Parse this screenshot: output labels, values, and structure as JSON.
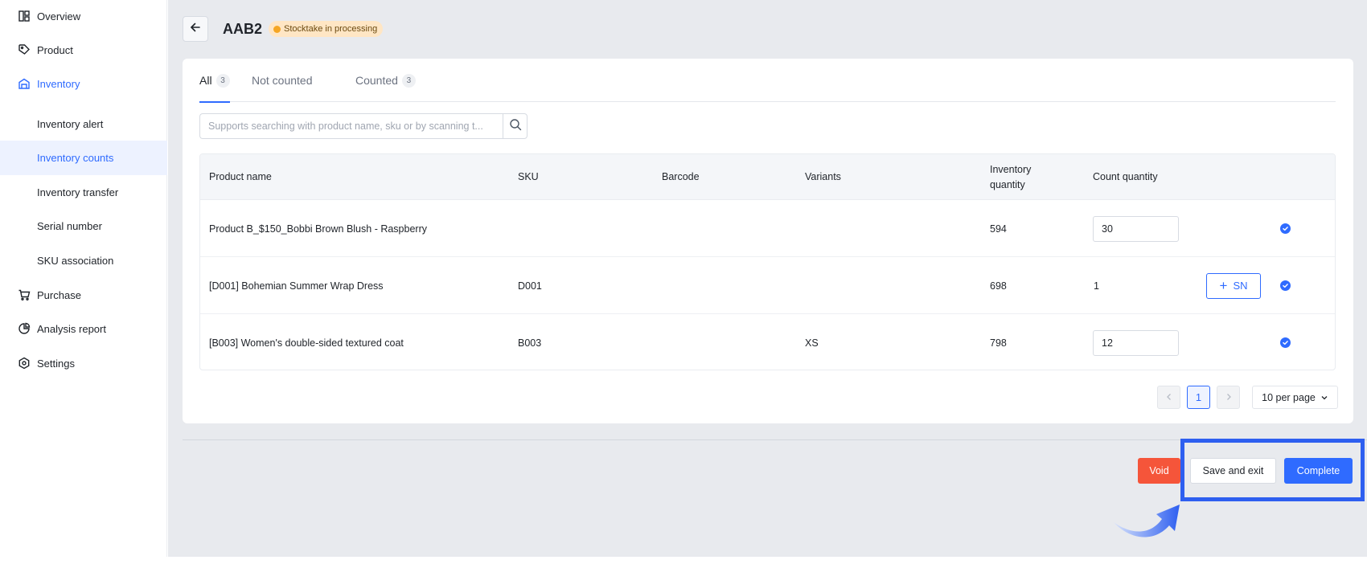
{
  "sidebar": {
    "items": [
      {
        "label": "Overview",
        "icon": "layout-grid-icon"
      },
      {
        "label": "Product",
        "icon": "tag-icon"
      },
      {
        "label": "Inventory",
        "icon": "warehouse-icon"
      },
      {
        "label": "Inventory alert"
      },
      {
        "label": "Inventory counts"
      },
      {
        "label": "Inventory transfer"
      },
      {
        "label": "Serial number"
      },
      {
        "label": "SKU association"
      },
      {
        "label": "Purchase",
        "icon": "cart-icon"
      },
      {
        "label": "Analysis report",
        "icon": "pie-chart-icon"
      },
      {
        "label": "Settings",
        "icon": "settings-hex-icon"
      }
    ]
  },
  "header": {
    "title": "AAB2",
    "status": "Stocktake in processing"
  },
  "tabs": [
    {
      "label": "All",
      "count": "3"
    },
    {
      "label": "Not counted"
    },
    {
      "label": "Counted",
      "count": "3"
    }
  ],
  "search": {
    "placeholder": "Supports searching with product name, sku or by scanning t..."
  },
  "table": {
    "headers": [
      "Product name",
      "SKU",
      "Barcode",
      "Variants",
      "Inventory quantity",
      "Count quantity"
    ],
    "header_inventory_line1": "Inventory",
    "header_inventory_line2": "quantity",
    "rows": [
      {
        "name": "Product B_$150_Bobbi Brown Blush - Raspberry",
        "sku": "",
        "barcode": "",
        "variants": "",
        "inventory": "594",
        "count": "30"
      },
      {
        "name": "[D001] Bohemian Summer Wrap Dress",
        "sku": "D001",
        "barcode": "",
        "variants": "",
        "inventory": "698",
        "count": "1",
        "sn_label": "SN"
      },
      {
        "name": "[B003] Women's double-sided textured coat",
        "sku": "B003",
        "barcode": "",
        "variants": "XS",
        "inventory": "798",
        "count": "12"
      }
    ]
  },
  "pagination": {
    "current_page": "1",
    "per_page": "10 per page"
  },
  "actions": {
    "void": "Void",
    "save_exit": "Save and exit",
    "complete": "Complete"
  },
  "colors": {
    "accent": "#2f6bff",
    "danger": "#f5553a",
    "status_bg": "#ffe6c4",
    "highlight": "#2e5ff0"
  }
}
